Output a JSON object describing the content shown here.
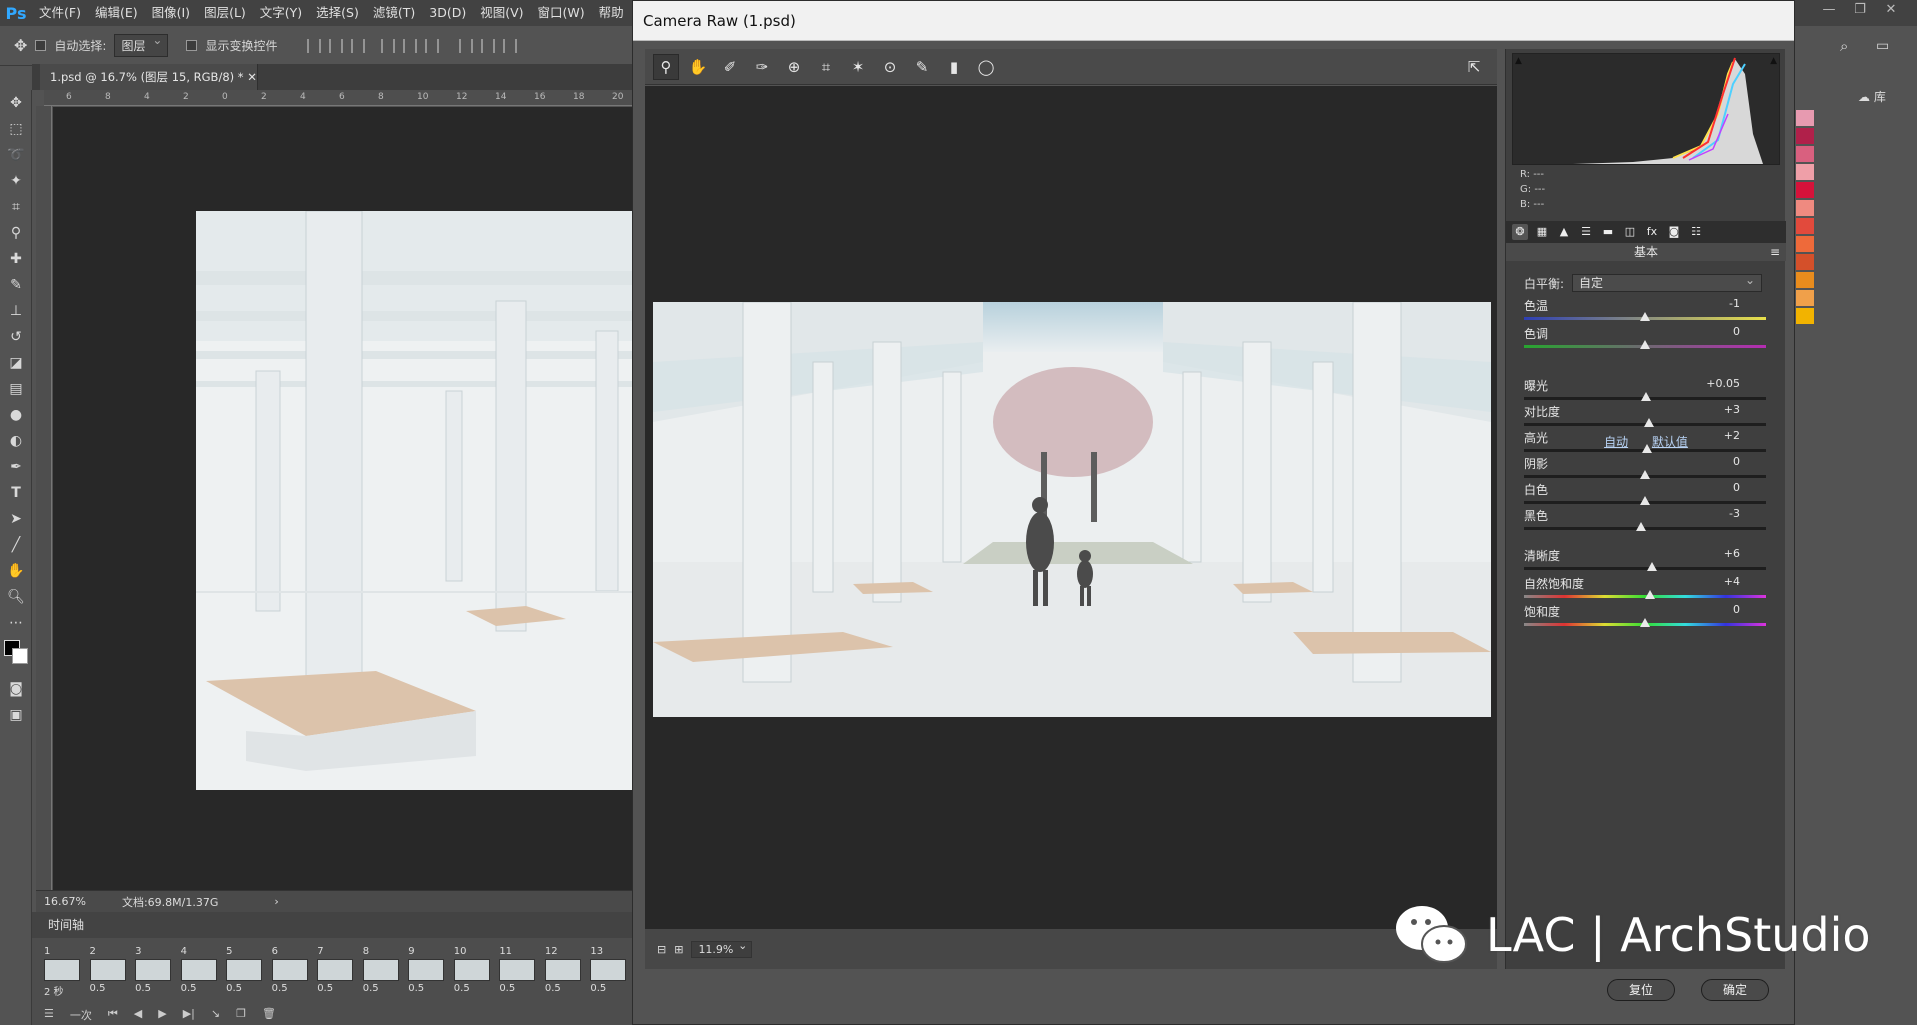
{
  "app": {
    "logo": "Ps",
    "menu": [
      "文件(F)",
      "编辑(E)",
      "图像(I)",
      "图层(L)",
      "文字(Y)",
      "选择(S)",
      "滤镜(T)",
      "3D(D)",
      "视图(V)",
      "窗口(W)",
      "帮助"
    ]
  },
  "options": {
    "auto_select_label": "自动选择:",
    "auto_select_value": "图层",
    "show_transform_label": "显示变换控件"
  },
  "document": {
    "tab_title": "1.psd @ 16.7% (图层 15, RGB/8) *",
    "ruler_ticks": [
      "6",
      "8",
      "4",
      "2",
      "0",
      "2",
      "4",
      "6",
      "8",
      "10",
      "12",
      "14",
      "16",
      "18",
      "20"
    ],
    "zoom": "16.67%",
    "doc_size": "文档:69.8M/1.37G"
  },
  "timeline": {
    "title": "时间轴",
    "frames": [
      {
        "num": "1",
        "delay": "2 秒"
      },
      {
        "num": "2",
        "delay": "0.5"
      },
      {
        "num": "3",
        "delay": "0.5"
      },
      {
        "num": "4",
        "delay": "0.5"
      },
      {
        "num": "5",
        "delay": "0.5"
      },
      {
        "num": "6",
        "delay": "0.5"
      },
      {
        "num": "7",
        "delay": "0.5"
      },
      {
        "num": "8",
        "delay": "0.5"
      },
      {
        "num": "9",
        "delay": "0.5"
      },
      {
        "num": "10",
        "delay": "0.5"
      },
      {
        "num": "11",
        "delay": "0.5"
      },
      {
        "num": "12",
        "delay": "0.5"
      },
      {
        "num": "13",
        "delay": "0.5"
      }
    ],
    "loop": "一次"
  },
  "camera_raw": {
    "title": "Camera Raw (1.psd)",
    "zoom": "11.9%",
    "rgb": {
      "r_label": "R:",
      "g_label": "G:",
      "b_label": "B:",
      "value": "---"
    },
    "panel_title": "基本",
    "white_balance_label": "白平衡:",
    "white_balance_value": "自定",
    "auto_label": "自动",
    "default_label": "默认值",
    "sliders": [
      {
        "label": "色温",
        "value": "-1",
        "pos": 0.5
      },
      {
        "label": "色调",
        "value": "0",
        "pos": 0.5
      },
      {
        "label": "曝光",
        "value": "+0.05",
        "pos": 0.505
      },
      {
        "label": "对比度",
        "value": "+3",
        "pos": 0.515
      },
      {
        "label": "高光",
        "value": "+2",
        "pos": 0.51
      },
      {
        "label": "阴影",
        "value": "0",
        "pos": 0.5
      },
      {
        "label": "白色",
        "value": "0",
        "pos": 0.5
      },
      {
        "label": "黑色",
        "value": "-3",
        "pos": 0.485
      },
      {
        "label": "清晰度",
        "value": "+6",
        "pos": 0.53
      },
      {
        "label": "自然饱和度",
        "value": "+4",
        "pos": 0.52
      },
      {
        "label": "饱和度",
        "value": "0",
        "pos": 0.5
      }
    ],
    "reset_label": "复位",
    "ok_label": "确定"
  },
  "watermark": "LAC | ArchStudio",
  "right_panel_label": "库"
}
